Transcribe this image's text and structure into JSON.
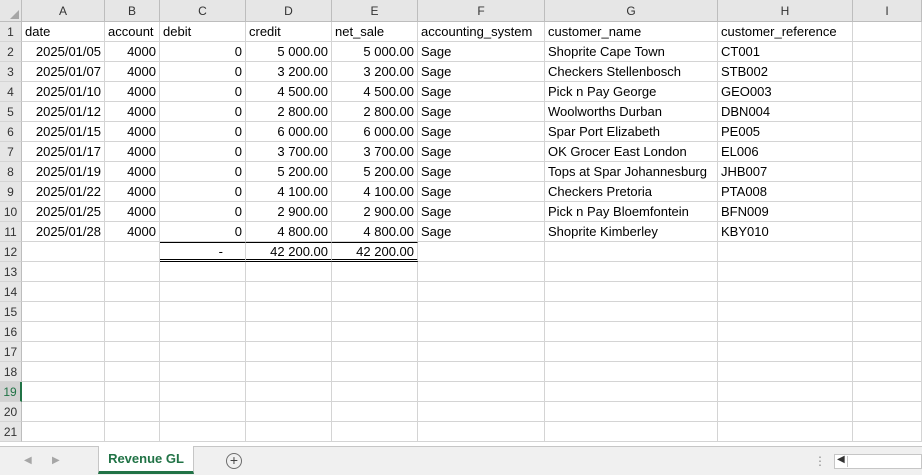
{
  "sheet": {
    "columns": [
      "A",
      "B",
      "C",
      "D",
      "E",
      "F",
      "G",
      "H",
      "I"
    ],
    "row_numbers": [
      "1",
      "2",
      "3",
      "4",
      "5",
      "6",
      "7",
      "8",
      "9",
      "10",
      "11",
      "12",
      "13",
      "14",
      "15",
      "16",
      "17",
      "18",
      "19",
      "20",
      "21"
    ],
    "selected_row": "19",
    "header_row": [
      "date",
      "account",
      "debit",
      "credit",
      "net_sale",
      "accounting_system",
      "customer_name",
      "customer_reference",
      ""
    ],
    "rows": [
      [
        "2025/01/05",
        "4000",
        "0",
        "5 000.00",
        "5 000.00",
        "Sage",
        "Shoprite Cape Town",
        "CT001",
        ""
      ],
      [
        "2025/01/07",
        "4000",
        "0",
        "3 200.00",
        "3 200.00",
        "Sage",
        "Checkers Stellenbosch",
        "STB002",
        ""
      ],
      [
        "2025/01/10",
        "4000",
        "0",
        "4 500.00",
        "4 500.00",
        "Sage",
        "Pick n Pay George",
        "GEO003",
        ""
      ],
      [
        "2025/01/12",
        "4000",
        "0",
        "2 800.00",
        "2 800.00",
        "Sage",
        "Woolworths Durban",
        "DBN004",
        ""
      ],
      [
        "2025/01/15",
        "4000",
        "0",
        "6 000.00",
        "6 000.00",
        "Sage",
        "Spar Port Elizabeth",
        "PE005",
        ""
      ],
      [
        "2025/01/17",
        "4000",
        "0",
        "3 700.00",
        "3 700.00",
        "Sage",
        "OK Grocer East London",
        "EL006",
        ""
      ],
      [
        "2025/01/19",
        "4000",
        "0",
        "5 200.00",
        "5 200.00",
        "Sage",
        "Tops at Spar Johannesburg",
        "JHB007",
        ""
      ],
      [
        "2025/01/22",
        "4000",
        "0",
        "4 100.00",
        "4 100.00",
        "Sage",
        "Checkers Pretoria",
        "PTA008",
        ""
      ],
      [
        "2025/01/25",
        "4000",
        "0",
        "2 900.00",
        "2 900.00",
        "Sage",
        "Pick n Pay Bloemfontein",
        "BFN009",
        ""
      ],
      [
        "2025/01/28",
        "4000",
        "0",
        "4 800.00",
        "4 800.00",
        "Sage",
        "Shoprite Kimberley",
        "KBY010",
        ""
      ]
    ],
    "totals_row": [
      "",
      "",
      "-",
      "42 200.00",
      "42 200.00",
      "",
      "",
      "",
      ""
    ]
  },
  "tabs": {
    "active_sheet": "Revenue GL",
    "add_sheet_icon": "plus-circle-icon",
    "options_glyph": "⋮"
  },
  "colors": {
    "accent": "#217346",
    "header_bg": "#e6e6e6",
    "gridline": "#d4d4d4"
  }
}
